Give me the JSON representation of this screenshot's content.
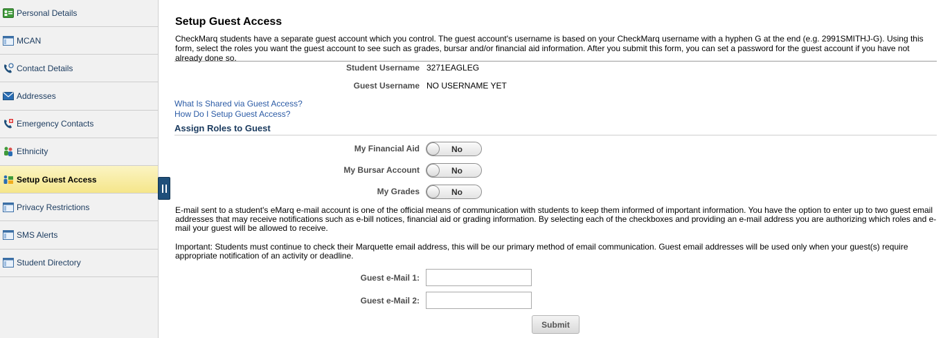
{
  "sidebar": {
    "items": [
      {
        "label": "Personal Details",
        "icon": "id-card-icon"
      },
      {
        "label": "MCAN",
        "icon": "window-icon"
      },
      {
        "label": "Contact Details",
        "icon": "phone-icon"
      },
      {
        "label": "Addresses",
        "icon": "envelope-icon"
      },
      {
        "label": "Emergency Contacts",
        "icon": "emergency-phone-icon"
      },
      {
        "label": "Ethnicity",
        "icon": "people-icon"
      },
      {
        "label": "Setup Guest Access",
        "icon": "guest-access-icon"
      },
      {
        "label": "Privacy Restrictions",
        "icon": "window-icon"
      },
      {
        "label": "SMS Alerts",
        "icon": "window-icon"
      },
      {
        "label": "Student Directory",
        "icon": "window-icon"
      }
    ],
    "active_index": 6
  },
  "main": {
    "title": "Setup Guest Access",
    "intro": "CheckMarq students have a separate guest account which you control. The guest account's username is based on your CheckMarq username with a hyphen G at the end (e.g. 2991SMITHJ-G). Using this form, select the roles you want the guest account to see such as grades, bursar and/or financial aid information. After you submit this form, you can set a password for the guest account if you have not already done so.",
    "student_username_label": "Student Username",
    "student_username_value": "3271EAGLEG",
    "guest_username_label": "Guest Username",
    "guest_username_value": "NO USERNAME YET",
    "link_shared": "What Is Shared via Guest Access?",
    "link_setup": "How Do I Setup Guest Access?",
    "roles_title": "Assign Roles to Guest",
    "roles": [
      {
        "label": "My Financial Aid",
        "state": "No"
      },
      {
        "label": "My Bursar Account",
        "state": "No"
      },
      {
        "label": "My Grades",
        "state": "No"
      }
    ],
    "email_paragraph": "E-mail sent to a student's eMarq e-mail account is one of the official means of communication with students to keep them informed of important information. You have the option to enter up to two guest email addresses that may receive notifications such as e-bill notices, financial aid or grading information. By selecting each of the checkboxes and providing an e-mail address you are authorizing which roles and e-mail your guest will be allowed to receive.",
    "important_paragraph": "Important: Students must continue to check their Marquette email address, this will be our primary method of email communication. Guest email addresses will be used only when your guest(s) require appropriate notification of an activity or deadline.",
    "email1_label": "Guest e-Mail 1:",
    "email1_value": "",
    "email2_label": "Guest e-Mail 2:",
    "email2_value": "",
    "submit_label": "Submit"
  },
  "colors": {
    "active_nav_bg": "#f5e68a",
    "link": "#2a5aa5",
    "section_title": "#1a3a5e",
    "collapse_handle": "#1f4f7a"
  }
}
